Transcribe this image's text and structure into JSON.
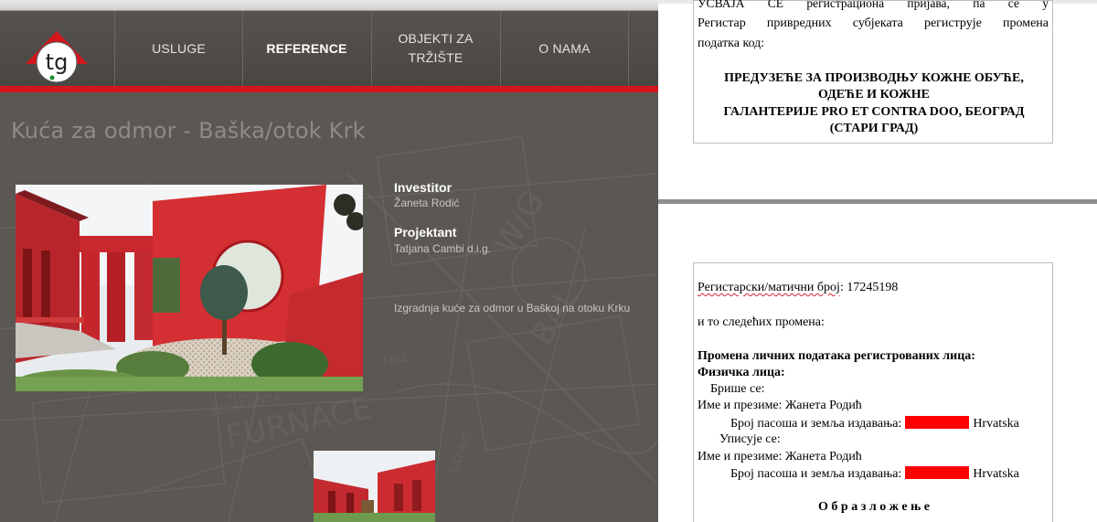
{
  "site": {
    "logo_text": "tg",
    "nav": [
      {
        "label": "USLUGE",
        "active": false
      },
      {
        "label": "REFERENCE",
        "active": true
      },
      {
        "label": "OBJEKTI ZA\nTRŽIŠTE",
        "active": false
      },
      {
        "label": "O NAMA",
        "active": false
      }
    ],
    "page_title": "Kuća za odmor - Baška/otok Krk",
    "investor_label": "Investitor",
    "investor_value": "Žaneta Rodić",
    "designer_label": "Projektant",
    "designer_value": "Tatjana Cambi d.i.g.",
    "description": "Izgradnja kuće za odmor u Baškoj na otoku Krku",
    "colors": {
      "nav_bg": "#4d4a46",
      "accent_red": "#d4161d",
      "page_bg": "#5b5753"
    }
  },
  "document": {
    "box1": {
      "line1": "УСВАЈА СЕ регистрациона пријава, па се у",
      "line2": "Регистар привредних субјеката региструје промена",
      "line3": "податка код:",
      "company": [
        "ПРЕДУЗЕЋЕ ЗА ПРОИЗВОДЊУ КОЖНЕ ОБУЋЕ,",
        "ОДЕЋЕ И КОЖНЕ",
        "ГАЛАНТЕРИЈЕ PRO ET CONTRA DOO, БЕОГРАД",
        "(СТАРИ ГРАД)"
      ]
    },
    "box2": {
      "reg_label": "Регистарски/матични број",
      "reg_number": ": 17245198",
      "changes_intro": "и то следећих промена:",
      "heading1": "Промена личних података регистрованих лица:",
      "heading2": "Физичка лица:",
      "deleted_label": "Брише се:",
      "name_label_1": "Име и презиме: Жанета Родић",
      "passport_label_1": "Број пасоша и земља издавања:",
      "country_1": "Hrvatska",
      "added_label": "Уписује се:",
      "name_label_2": "Име и презиме: Жанета Родић",
      "passport_label_2": "Број пасоша и земља издавања:",
      "country_2": "Hrvatska",
      "explanation_heading": "О б р а з л о ж е њ е"
    }
  }
}
